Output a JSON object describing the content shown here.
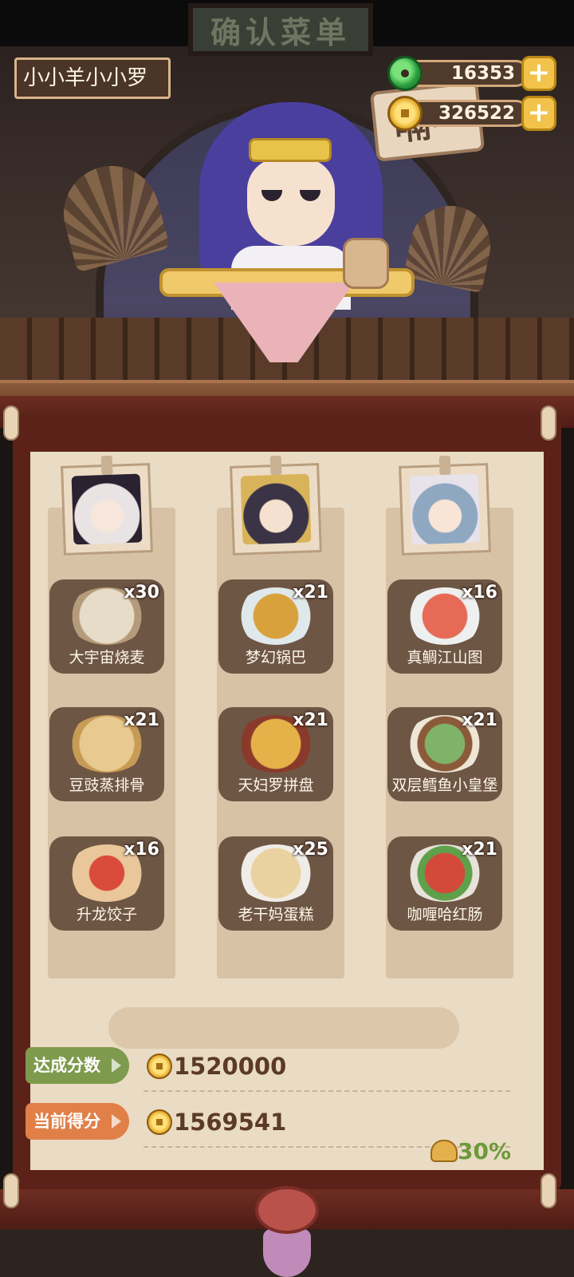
{
  "player": {
    "name": "小小羊小小罗"
  },
  "sign_text": "确认菜单",
  "speech_text": "嗝~",
  "currency": [
    {
      "icon": "jade-icon",
      "value": "16353"
    },
    {
      "icon": "coin-icon",
      "value": "326522"
    }
  ],
  "columns": [
    {
      "portrait_color": "#e9e3e4",
      "dishes": [
        {
          "name": "大宇宙烧麦",
          "count": "x30",
          "color": "#e7dcc8"
        },
        {
          "name": "豆豉蒸排骨",
          "count": "x21",
          "color": "#e8c98f"
        },
        {
          "name": "升龙饺子",
          "count": "x16",
          "color": "#d94b3a"
        }
      ]
    },
    {
      "portrait_color": "#3b3446",
      "dishes": [
        {
          "name": "梦幻锅巴",
          "count": "x21",
          "color": "#d9a13c"
        },
        {
          "name": "天妇罗拼盘",
          "count": "x21",
          "color": "#e5b24a"
        },
        {
          "name": "老干妈蛋糕",
          "count": "x25",
          "color": "#e9d2a0"
        }
      ]
    },
    {
      "portrait_color": "#8ea8c2",
      "dishes": [
        {
          "name": "真鲷江山图",
          "count": "x16",
          "color": "#e66a55"
        },
        {
          "name": "双层鳕鱼小皇堡",
          "count": "x21",
          "color": "#7fb36a"
        },
        {
          "name": "咖喱哈红肠",
          "count": "x21",
          "color": "#d44a3a"
        }
      ]
    }
  ],
  "scores": {
    "target": {
      "label": "达成分数",
      "value": "1520000",
      "color": "#7e9a4c"
    },
    "current": {
      "label": "当前得分",
      "value": "1569541",
      "color": "#e08048"
    }
  },
  "bonus_percent": "30%"
}
